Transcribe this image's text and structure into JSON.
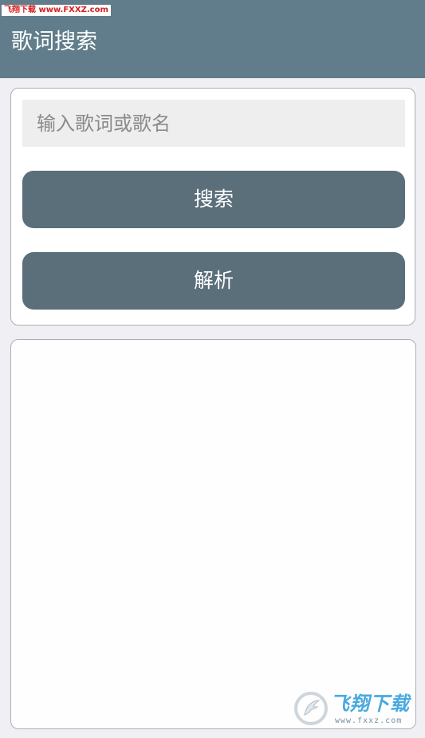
{
  "status_bar": {
    "watermark_text": "飞翔下载 www.FXXZ.com"
  },
  "app_bar": {
    "title": "歌词搜索",
    "background_color": "#617d8b"
  },
  "search_card": {
    "input": {
      "value": "",
      "placeholder": "输入歌词或歌名"
    },
    "search_button_label": "搜索",
    "parse_button_label": "解析",
    "button_color": "#5a6f7a"
  },
  "result_area": {
    "content": ""
  },
  "watermark": {
    "brand": "飞翔下载",
    "url": "www.fxxz.com",
    "icon": "fxxz-logo-icon"
  }
}
